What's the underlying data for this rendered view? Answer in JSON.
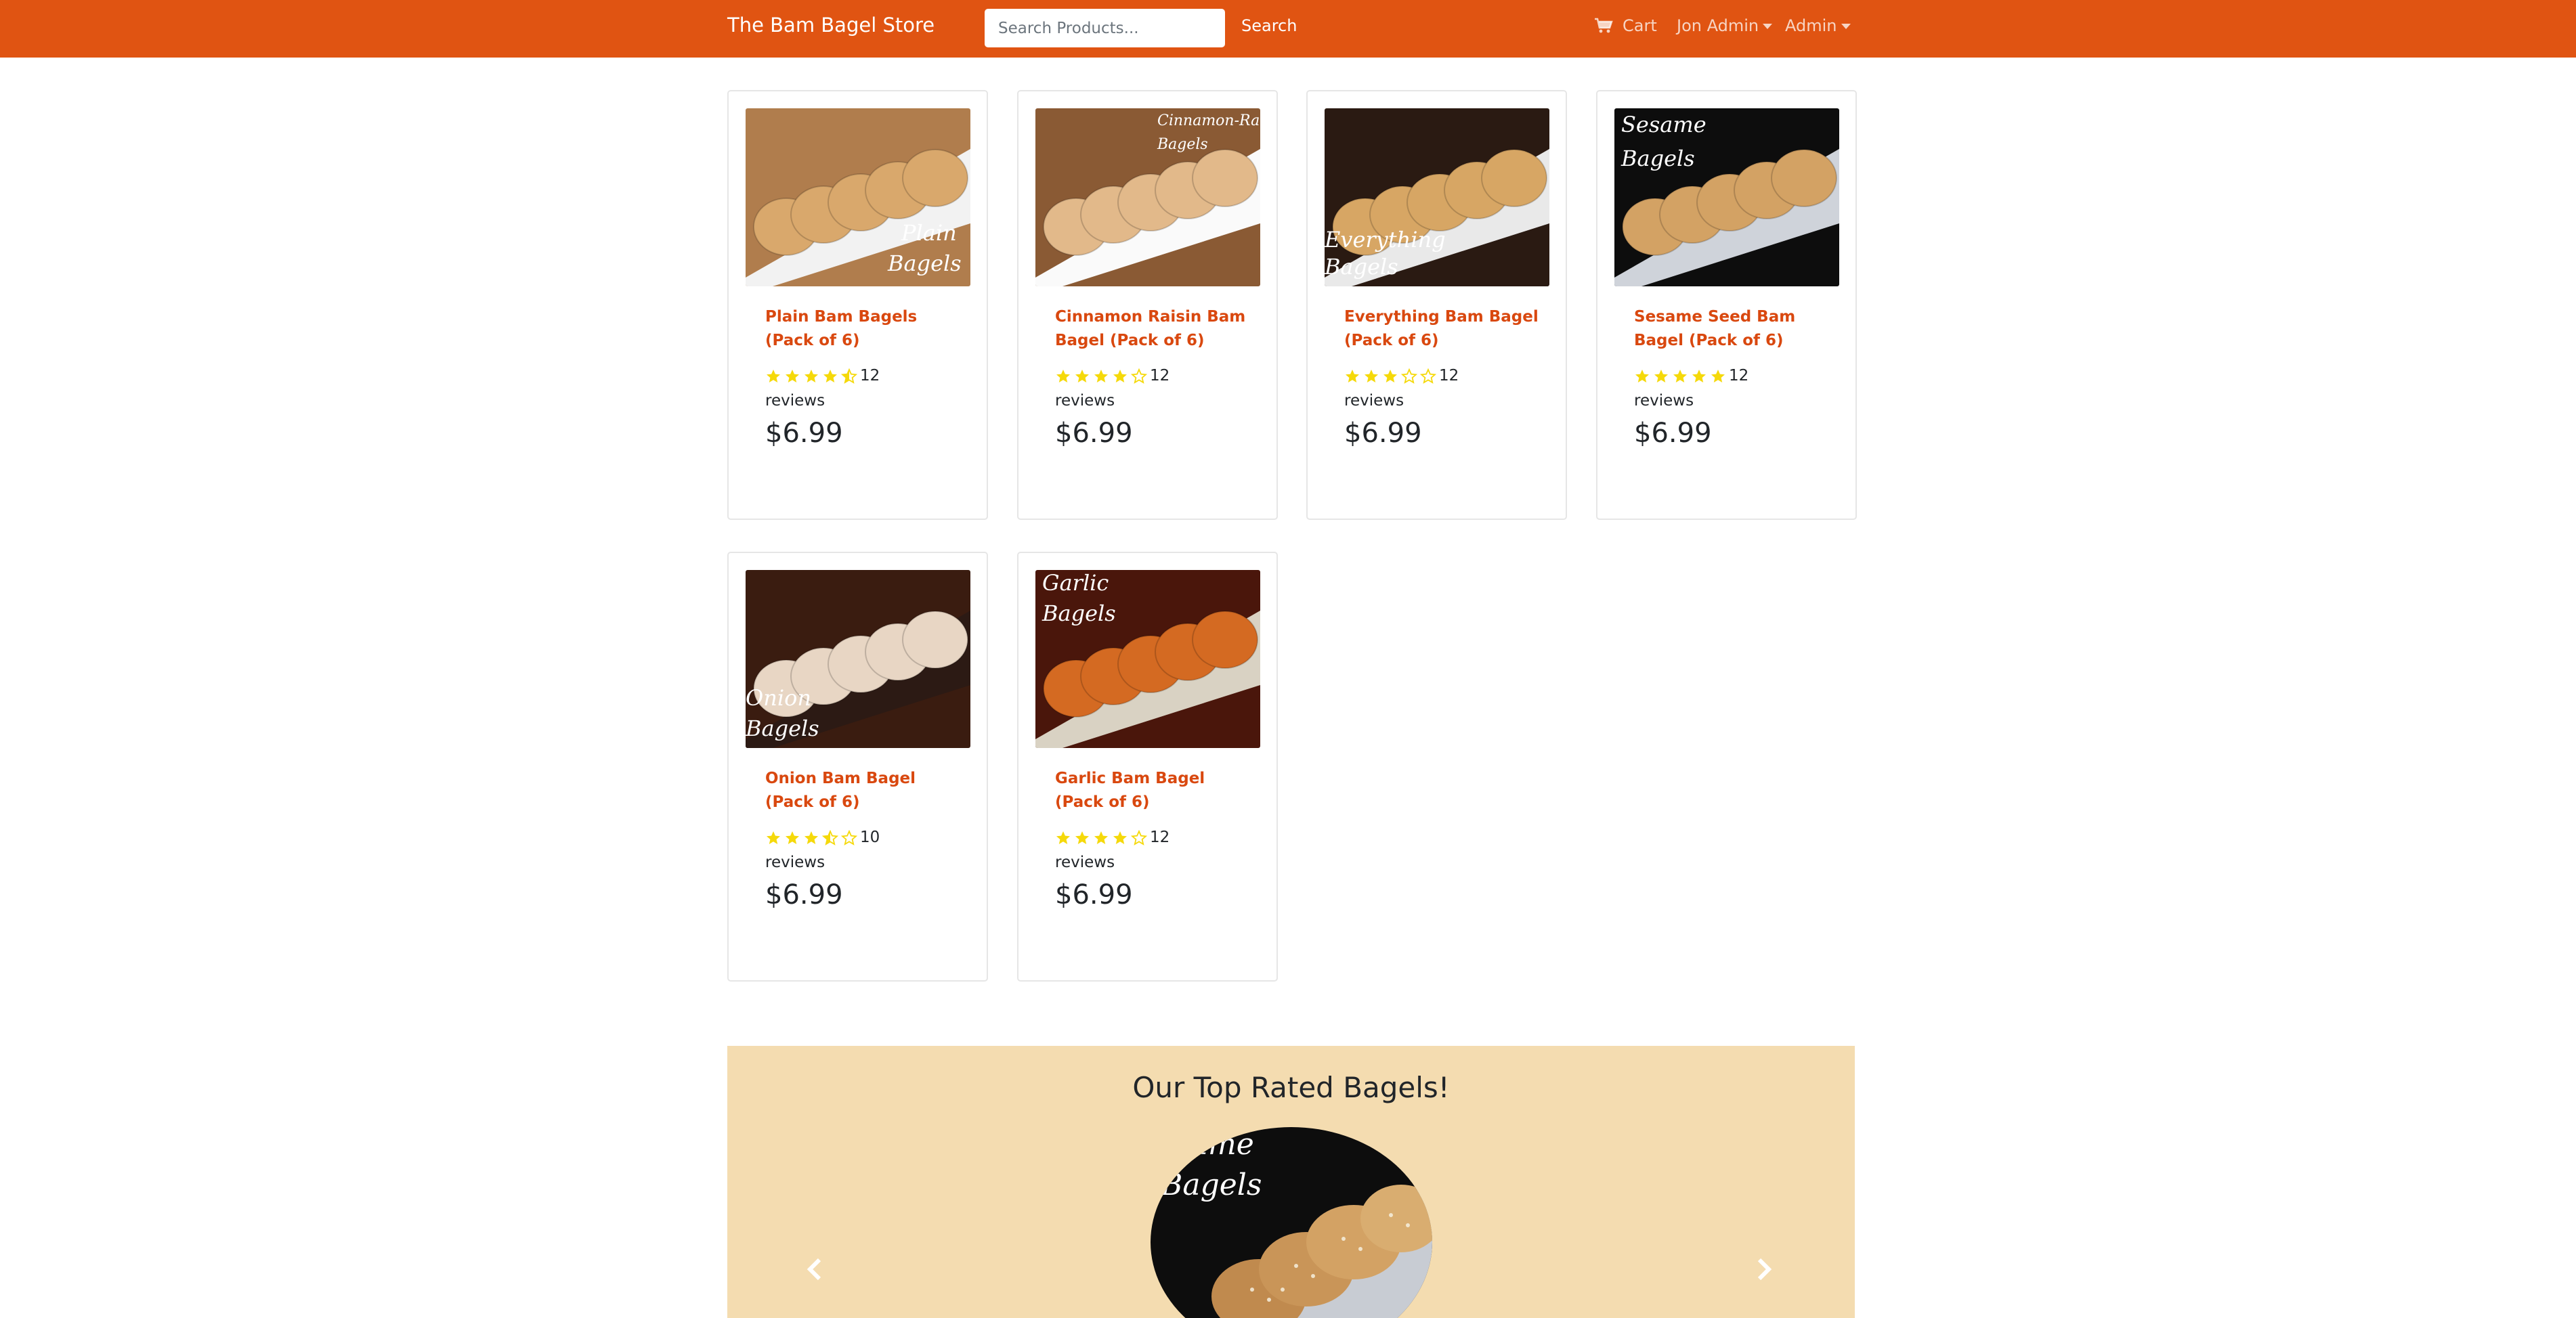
{
  "navbar": {
    "brand": "The Bam Bagel Store",
    "search_placeholder": "Search Products...",
    "search_button": "Search",
    "cart_label": "Cart",
    "cart_icon": "shopping-cart-icon",
    "user_menu": "Jon Admin",
    "admin_menu": "Admin",
    "bg_color": "#e05412"
  },
  "products": [
    {
      "name": "Plain Bam Bagels (Pack of 6)",
      "image_caption": "Plain Bagels",
      "rating": 4.5,
      "reviews": "12",
      "reviews_label": "reviews",
      "price": "$6.99"
    },
    {
      "name": "Cinnamon Raisin Bam Bagel (Pack of 6)",
      "image_caption": "Cinnamon-Raisin Bagels",
      "rating": 4,
      "reviews": "12",
      "reviews_label": "reviews",
      "price": "$6.99"
    },
    {
      "name": "Everything Bam Bagel (Pack of 6)",
      "image_caption": "Everything Bagels",
      "rating": 3,
      "reviews": "12",
      "reviews_label": "reviews",
      "price": "$6.99"
    },
    {
      "name": "Sesame Seed Bam Bagel (Pack of 6)",
      "image_caption": "Sesame Bagels",
      "rating": 5,
      "reviews": "12",
      "reviews_label": "reviews",
      "price": "$6.99"
    },
    {
      "name": "Onion Bam Bagel (Pack of 6)",
      "image_caption": "Onion Bagels",
      "rating": 3.5,
      "reviews": "10",
      "reviews_label": "reviews",
      "price": "$6.99"
    },
    {
      "name": "Garlic Bam Bagel (Pack of 6)",
      "image_caption": "Garlic Bagels",
      "rating": 4,
      "reviews": "12",
      "reviews_label": "reviews",
      "price": "$6.99"
    }
  ],
  "carousel": {
    "title": "Our Top Rated Bagels!",
    "image_caption": "Sesame Bagels",
    "prev_icon": "chevron-left-icon",
    "next_icon": "chevron-right-icon",
    "bg_color": "#f4dcb0"
  },
  "colors": {
    "accent": "#e05412",
    "link": "#d9480f",
    "star": "#f5d90a"
  }
}
